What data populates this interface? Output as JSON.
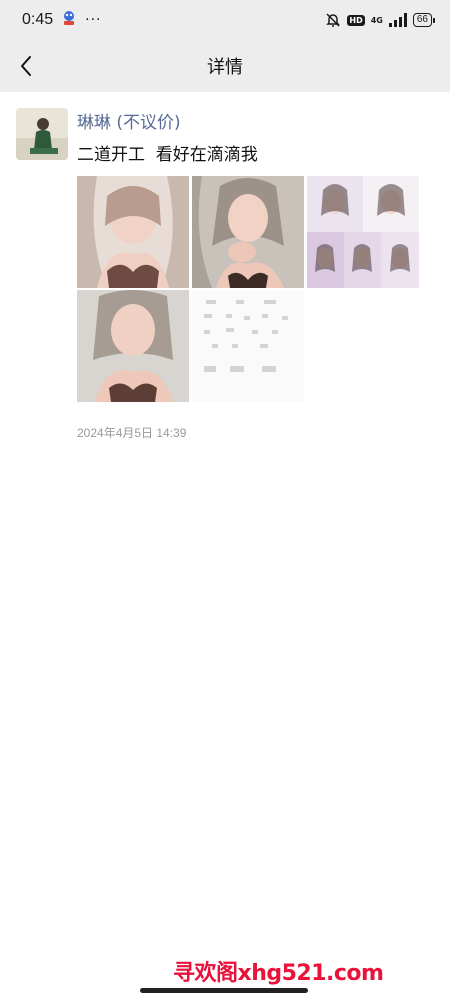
{
  "status_bar": {
    "time": "0:45",
    "more_glyph": "···",
    "hd_label": "HD",
    "network": "4G",
    "battery": "66"
  },
  "header": {
    "title": "详情"
  },
  "post": {
    "author": "琳琳 (不议价)",
    "text": "二道开工  看好在滴滴我",
    "timestamp": "2024年4月5日 14:39",
    "photos": [
      {
        "icon": "portrait-photo"
      },
      {
        "icon": "portrait-photo"
      },
      {
        "icon": "collage-photo"
      },
      {
        "icon": "portrait-photo"
      },
      {
        "icon": "screenshot-photo"
      }
    ]
  },
  "watermark": "寻欢阁xhg521.com",
  "colors": {
    "author": "#576b95",
    "bar_bg": "#ededed",
    "watermark": "#e8123a"
  }
}
